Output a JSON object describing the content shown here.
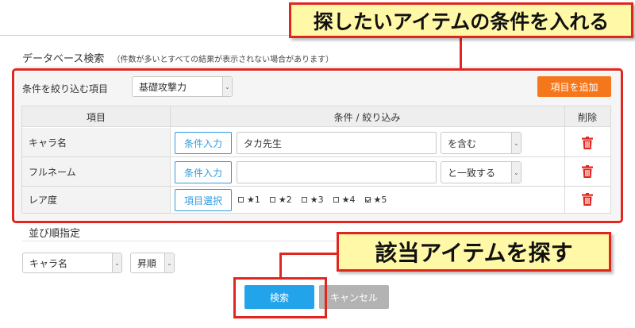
{
  "panel": {
    "title": "データベース検索",
    "note": "（件数が多いとすべての結果が表示されない場合があります）"
  },
  "filter": {
    "label": "条件を絞り込む項目",
    "select_value": "基礎攻撃力",
    "add_button": "項目を追加"
  },
  "table": {
    "headers": [
      "項目",
      "条件 / 絞り込み",
      "削除"
    ],
    "rows": [
      {
        "name": "キャラ名",
        "button": "条件入力",
        "input_value": "タカ先生",
        "match": "を含む"
      },
      {
        "name": "フルネーム",
        "button": "条件入力",
        "input_value": "",
        "match": "と一致する"
      },
      {
        "name": "レア度",
        "button": "項目選択"
      }
    ],
    "rarity_options": [
      {
        "label": "★1",
        "checked": false
      },
      {
        "label": "★2",
        "checked": false
      },
      {
        "label": "★3",
        "checked": false
      },
      {
        "label": "★4",
        "checked": false
      },
      {
        "label": "★5",
        "checked": true
      }
    ]
  },
  "sort": {
    "label": "並び順指定",
    "field_value": "キャラ名",
    "order_value": "昇順"
  },
  "actions": {
    "search": "検索",
    "cancel": "キャンセル"
  },
  "annotations": {
    "top": "探したいアイテムの条件を入れる",
    "bottom": "該当アイテムを探す"
  },
  "colors": {
    "accent_orange": "#f5771c",
    "search_blue": "#23a4ea",
    "trash_red": "#e0261f",
    "callout_yellow": "#fff8a6"
  }
}
